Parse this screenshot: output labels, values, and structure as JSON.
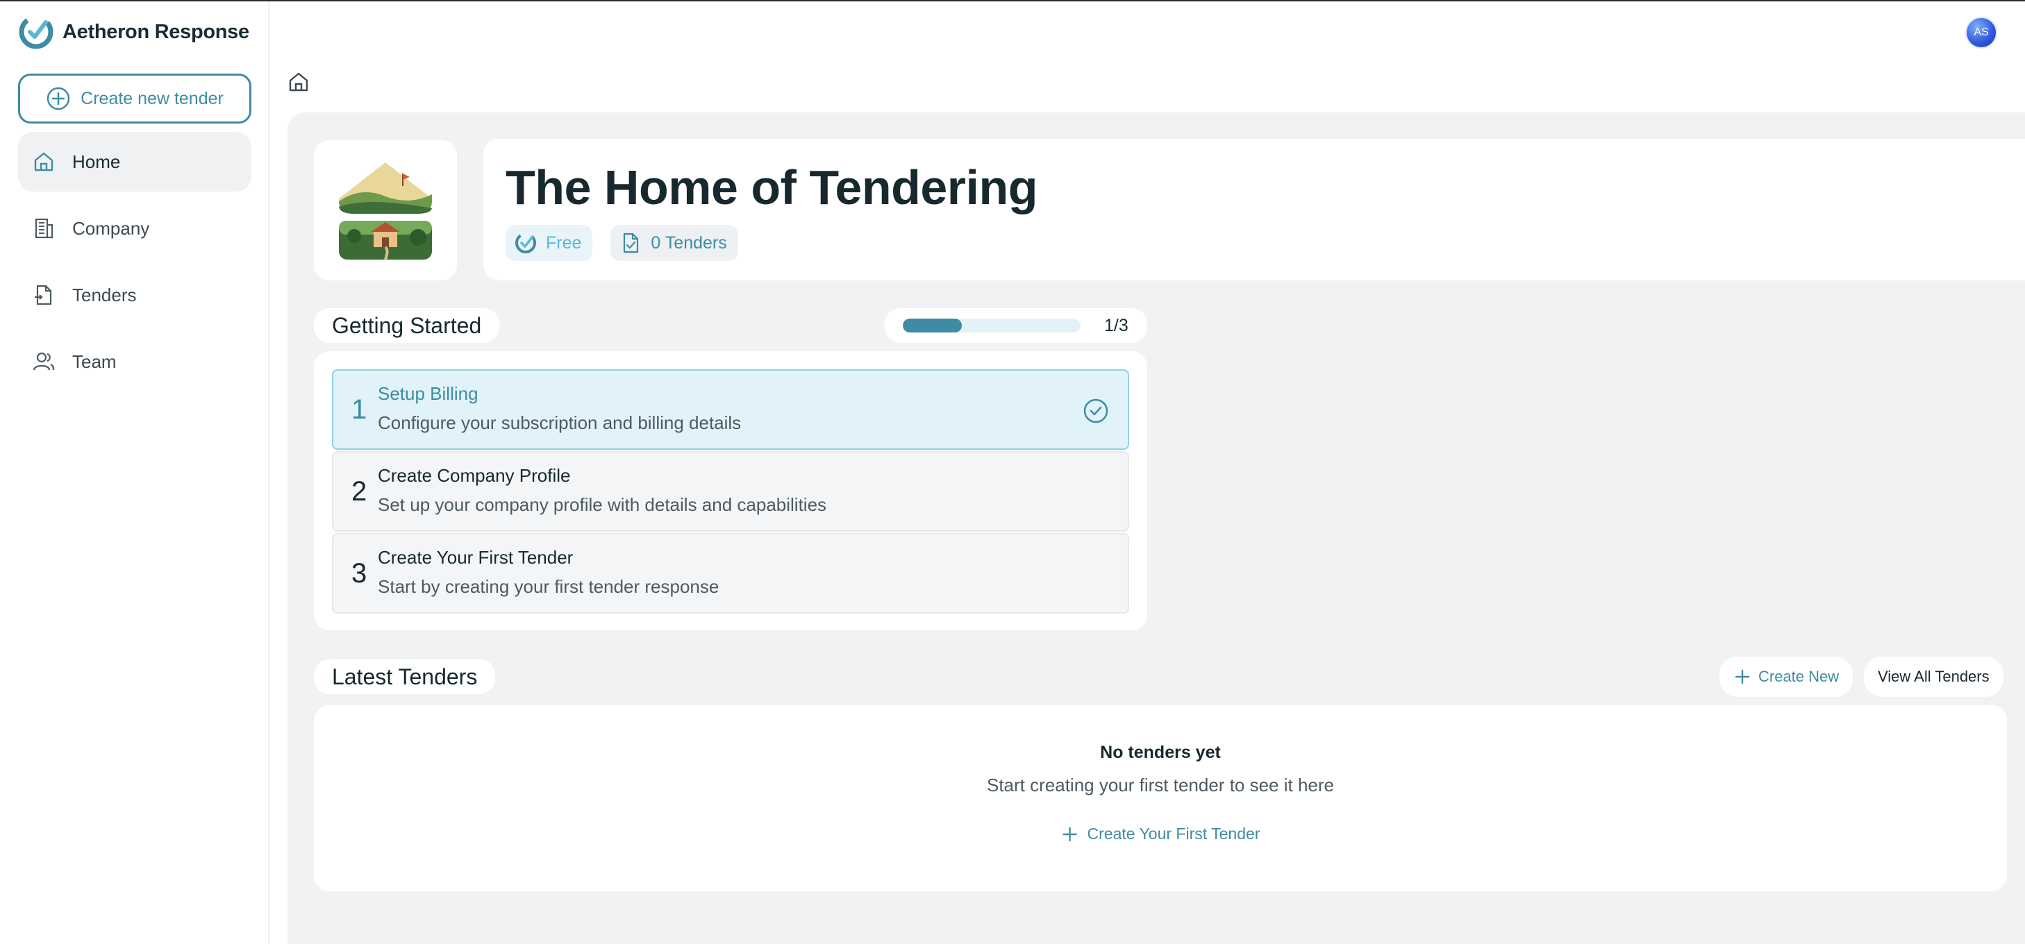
{
  "app": {
    "name": "Aetheron Response"
  },
  "sidebar": {
    "create_label": "Create new tender",
    "items": [
      {
        "label": "Home",
        "icon": "home-icon",
        "active": true
      },
      {
        "label": "Company",
        "icon": "building-icon",
        "active": false
      },
      {
        "label": "Tenders",
        "icon": "document-icon",
        "active": false
      },
      {
        "label": "Team",
        "icon": "users-icon",
        "active": false
      }
    ]
  },
  "header": {
    "avatar_initials": "AS"
  },
  "hero": {
    "title": "The Home of Tendering",
    "plan_label": "Free",
    "tenders_count_label": "0 Tenders"
  },
  "getting_started": {
    "title": "Getting Started",
    "progress_text": "1/3",
    "progress_fraction": 0.333,
    "steps": [
      {
        "number": "1",
        "title": "Setup Billing",
        "description": "Configure your subscription and billing details",
        "completed": true
      },
      {
        "number": "2",
        "title": "Create Company Profile",
        "description": "Set up your company profile with details and capabilities",
        "completed": false
      },
      {
        "number": "3",
        "title": "Create Your First Tender",
        "description": "Start by creating your first tender response",
        "completed": false
      }
    ]
  },
  "latest_tenders": {
    "title": "Latest Tenders",
    "create_new_label": "Create New",
    "view_all_label": "View All Tenders",
    "empty_title": "No tenders yet",
    "empty_subtitle": "Start creating your first tender to see it here",
    "empty_cta": "Create Your First Tender"
  },
  "colors": {
    "accent": "#3f8ba3",
    "accent_light": "#5ab8d3",
    "main_bg": "#f1f2f4",
    "step_done_bg": "#e1f3f9"
  }
}
